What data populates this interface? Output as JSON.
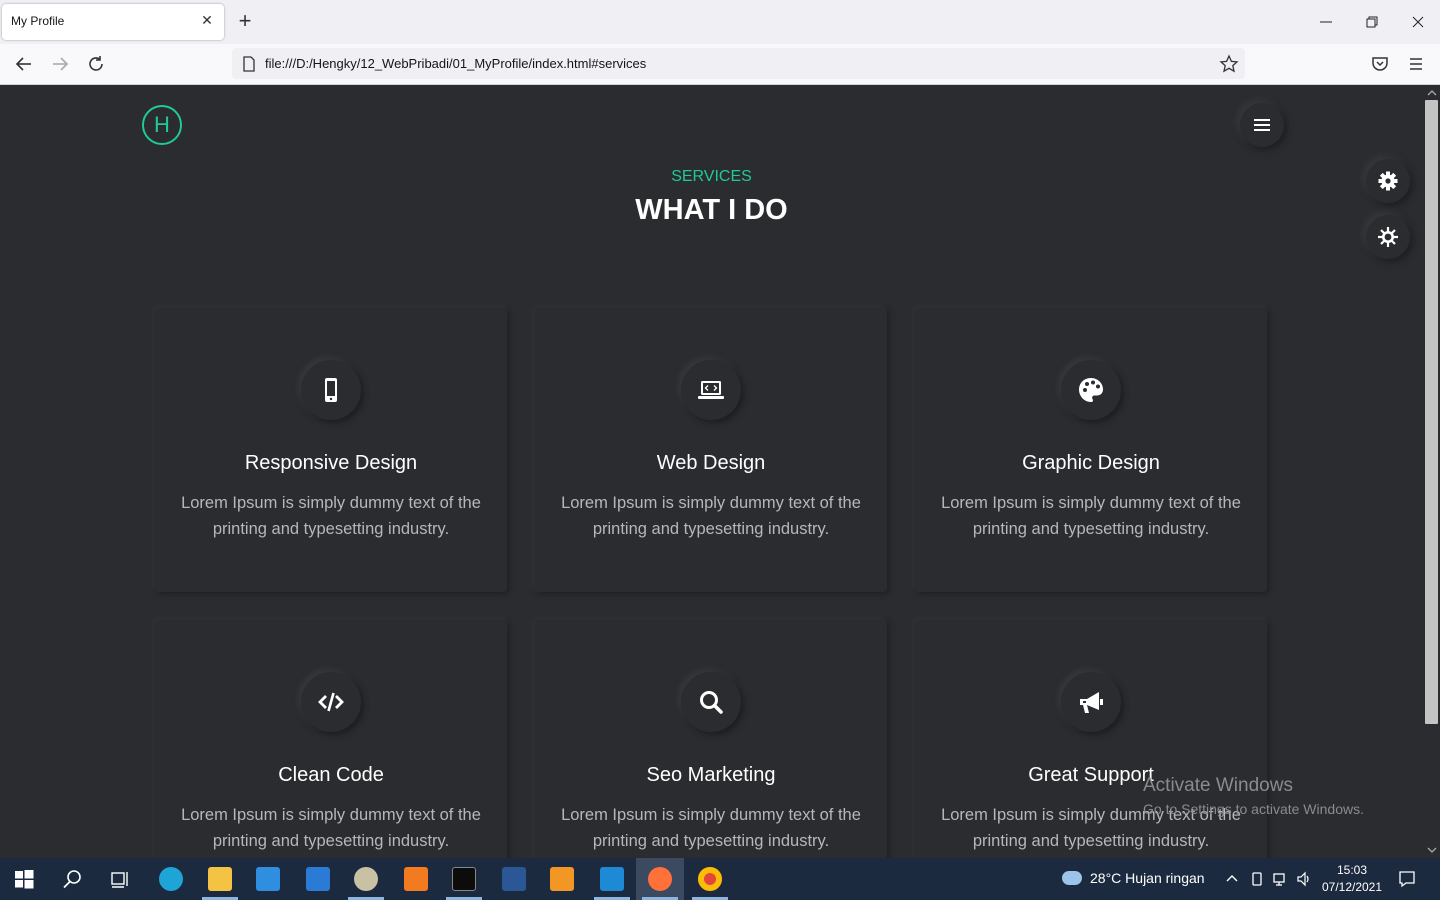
{
  "browser": {
    "tab_title": "My Profile",
    "url": "file:///D:/Hengky/12_WebPribadi/01_MyProfile/index.html#services"
  },
  "site": {
    "logo_letter": "H",
    "accent_color": "#20c997",
    "background_color": "#2b2c2f",
    "section_subtitle": "SERVICES",
    "section_title": "WHAT I DO",
    "services": [
      {
        "icon": "mobile-icon",
        "title": "Responsive Design",
        "text": "Lorem Ipsum is simply dummy text of the printing and typesetting industry."
      },
      {
        "icon": "laptop-code-icon",
        "title": "Web Design",
        "text": "Lorem Ipsum is simply dummy text of the printing and typesetting industry."
      },
      {
        "icon": "palette-icon",
        "title": "Graphic Design",
        "text": "Lorem Ipsum is simply dummy text of the printing and typesetting industry."
      },
      {
        "icon": "code-icon",
        "title": "Clean Code",
        "text": "Lorem Ipsum is simply dummy text of the printing and typesetting industry."
      },
      {
        "icon": "search-icon",
        "title": "Seo Marketing",
        "text": "Lorem Ipsum is simply dummy text of the printing and typesetting industry."
      },
      {
        "icon": "bullhorn-icon",
        "title": "Great Support",
        "text": "Lorem Ipsum is simply dummy text of the printing and typesetting industry."
      }
    ]
  },
  "watermark": {
    "title": "Activate Windows",
    "subtitle": "Go to Settings to activate Windows."
  },
  "taskbar": {
    "weather": "28°C  Hujan ringan",
    "time": "15:03",
    "date": "07/12/2021"
  }
}
